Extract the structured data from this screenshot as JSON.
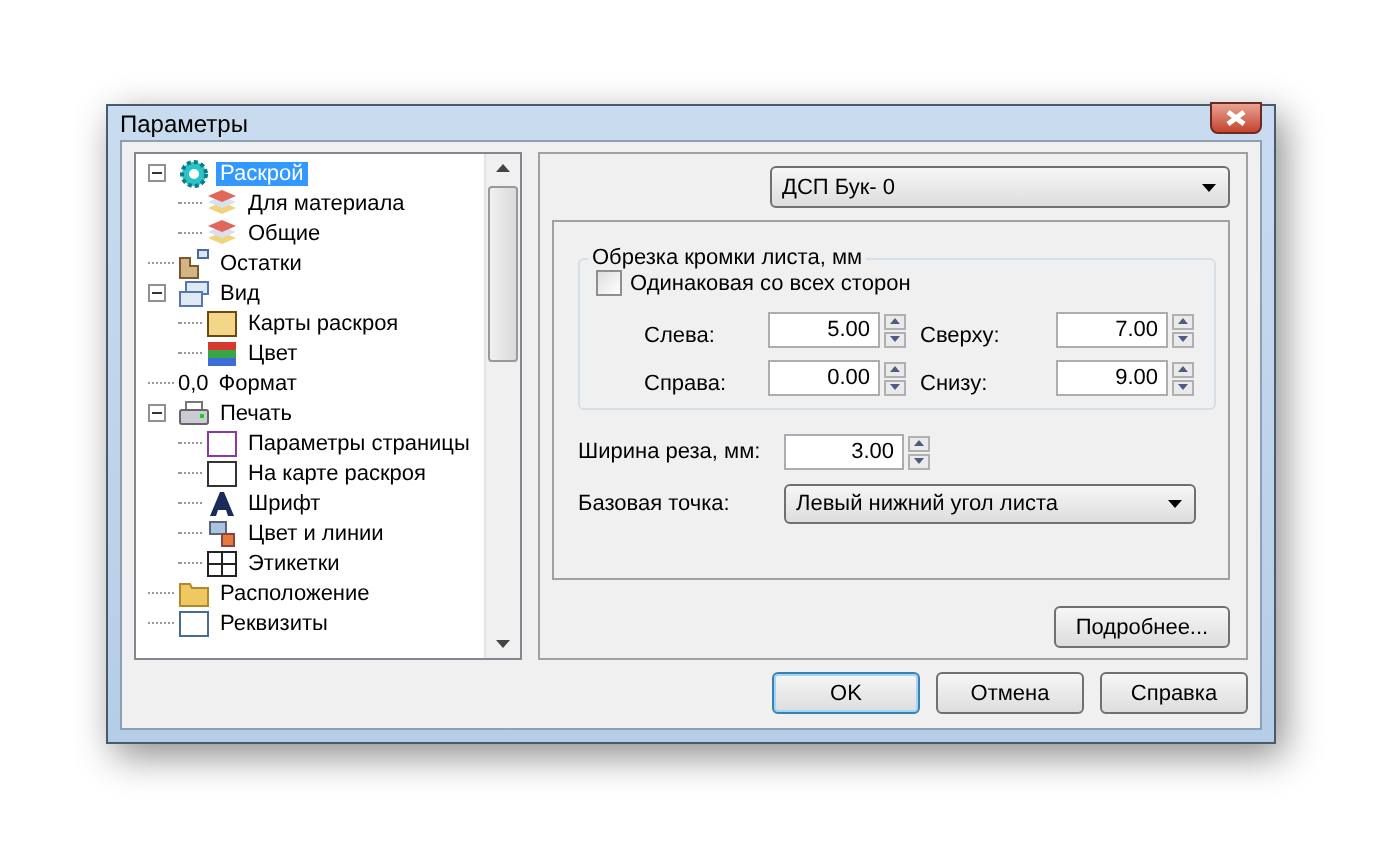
{
  "window": {
    "title": "Параметры"
  },
  "tree": [
    {
      "label": "Раскрой",
      "selected": true,
      "expanded": true,
      "children": [
        {
          "label": "Для материала",
          "selected": false
        },
        {
          "label": "Общие",
          "selected": false
        }
      ]
    },
    {
      "label": "Остатки",
      "selected": false
    },
    {
      "label": "Вид",
      "selected": false,
      "expanded": true,
      "children": [
        {
          "label": "Карты раскроя",
          "selected": false
        },
        {
          "label": "Цвет",
          "selected": false
        }
      ]
    },
    {
      "label": "Формат",
      "selected": false,
      "icon_text": "0,0"
    },
    {
      "label": "Печать",
      "selected": false,
      "expanded": true,
      "children": [
        {
          "label": "Параметры страницы",
          "selected": false
        },
        {
          "label": "На карте раскроя",
          "selected": false
        },
        {
          "label": "Шрифт",
          "selected": false
        },
        {
          "label": "Цвет и линии",
          "selected": false
        },
        {
          "label": "Этикетки",
          "selected": false
        }
      ]
    },
    {
      "label": "Расположение",
      "selected": false
    },
    {
      "label": "Реквизиты",
      "selected": false
    }
  ],
  "material_select": {
    "value": "ДСП Бук- 0"
  },
  "trim_group": {
    "title": "Обрезка кромки листа, мм",
    "same_all_sides": {
      "label": "Одинаковая со всех сторон",
      "checked": false
    },
    "fields": [
      {
        "label": "Слева:",
        "value": "5.00"
      },
      {
        "label": "Сверху:",
        "value": "7.00"
      },
      {
        "label": "Справа:",
        "value": "0.00"
      },
      {
        "label": "Снизу:",
        "value": "9.00"
      }
    ]
  },
  "kerf": {
    "label": "Ширина реза, мм:",
    "value": "3.00"
  },
  "base_point": {
    "label": "Базовая точка:",
    "value": "Левый нижний угол листа"
  },
  "more_button": "Подробнее...",
  "buttons": [
    {
      "label": "OK",
      "default": true
    },
    {
      "label": "Отмена",
      "default": false
    },
    {
      "label": "Справка",
      "default": false
    }
  ]
}
